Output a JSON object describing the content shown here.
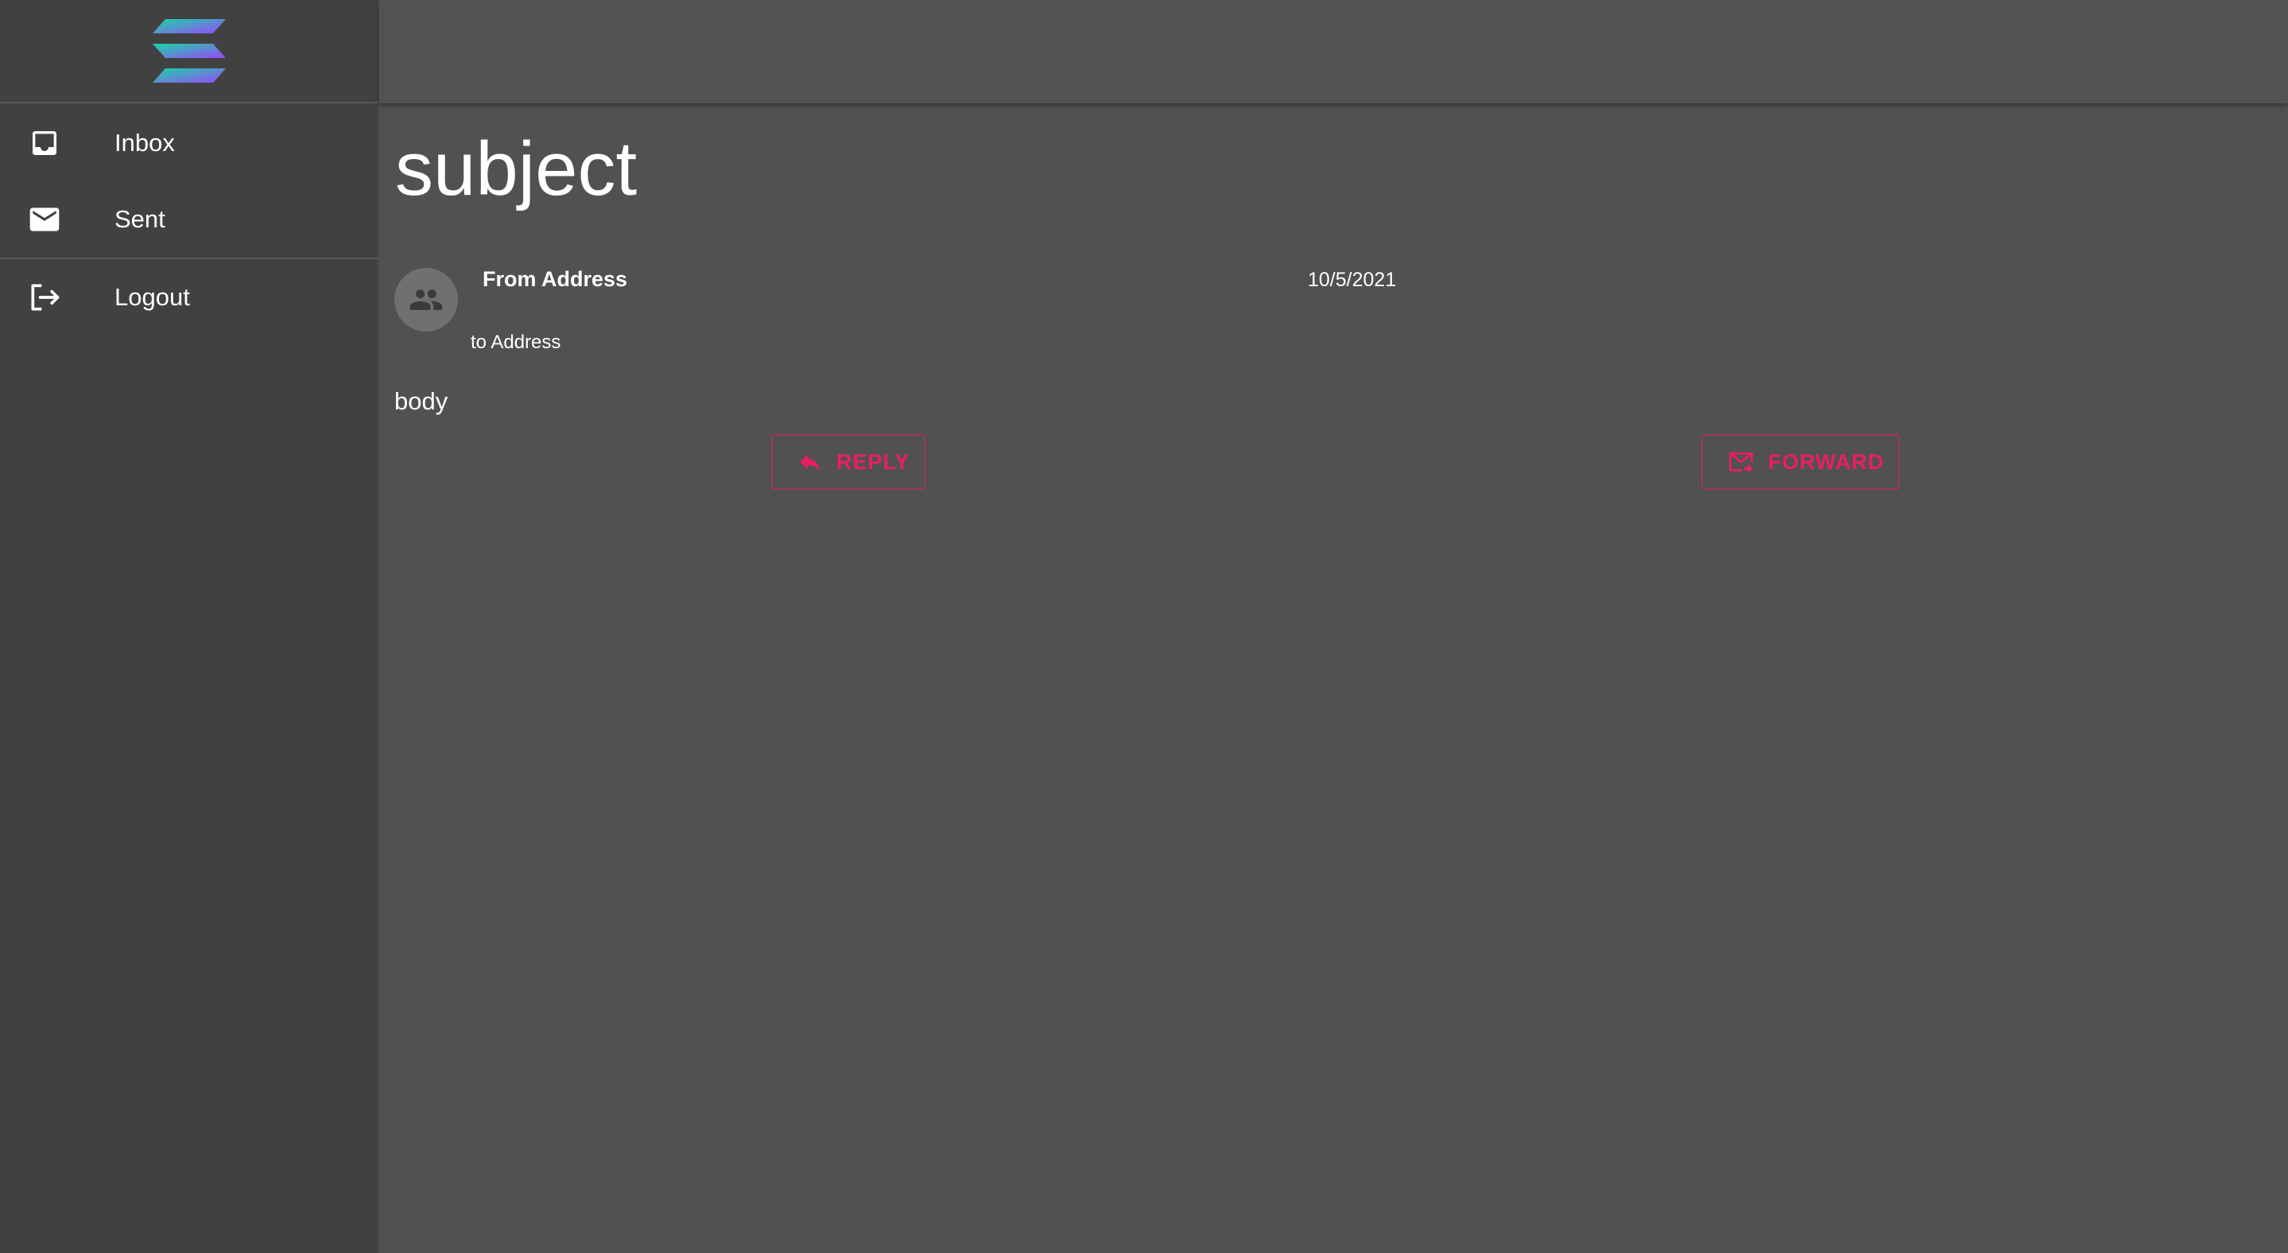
{
  "sidebar": {
    "logo": "solana-logo",
    "items": [
      {
        "label": "Inbox",
        "icon": "inbox-icon"
      },
      {
        "label": "Sent",
        "icon": "mail-icon"
      },
      {
        "label": "Logout",
        "icon": "logout-icon"
      }
    ]
  },
  "email": {
    "subject": "subject",
    "from": "From Address",
    "to": "to Address",
    "date": "10/5/2021",
    "body": "body",
    "avatar_icon": "people-icon"
  },
  "actions": {
    "reply_label": "REPLY",
    "reply_icon": "reply-icon",
    "forward_label": "FORWARD",
    "forward_icon": "forward-mail-icon"
  },
  "colors": {
    "accent": "#e91e63",
    "sidebar_bg": "#414141",
    "main_bg": "#515151",
    "logo_gradient": [
      "#14f195",
      "#9945ff"
    ]
  }
}
